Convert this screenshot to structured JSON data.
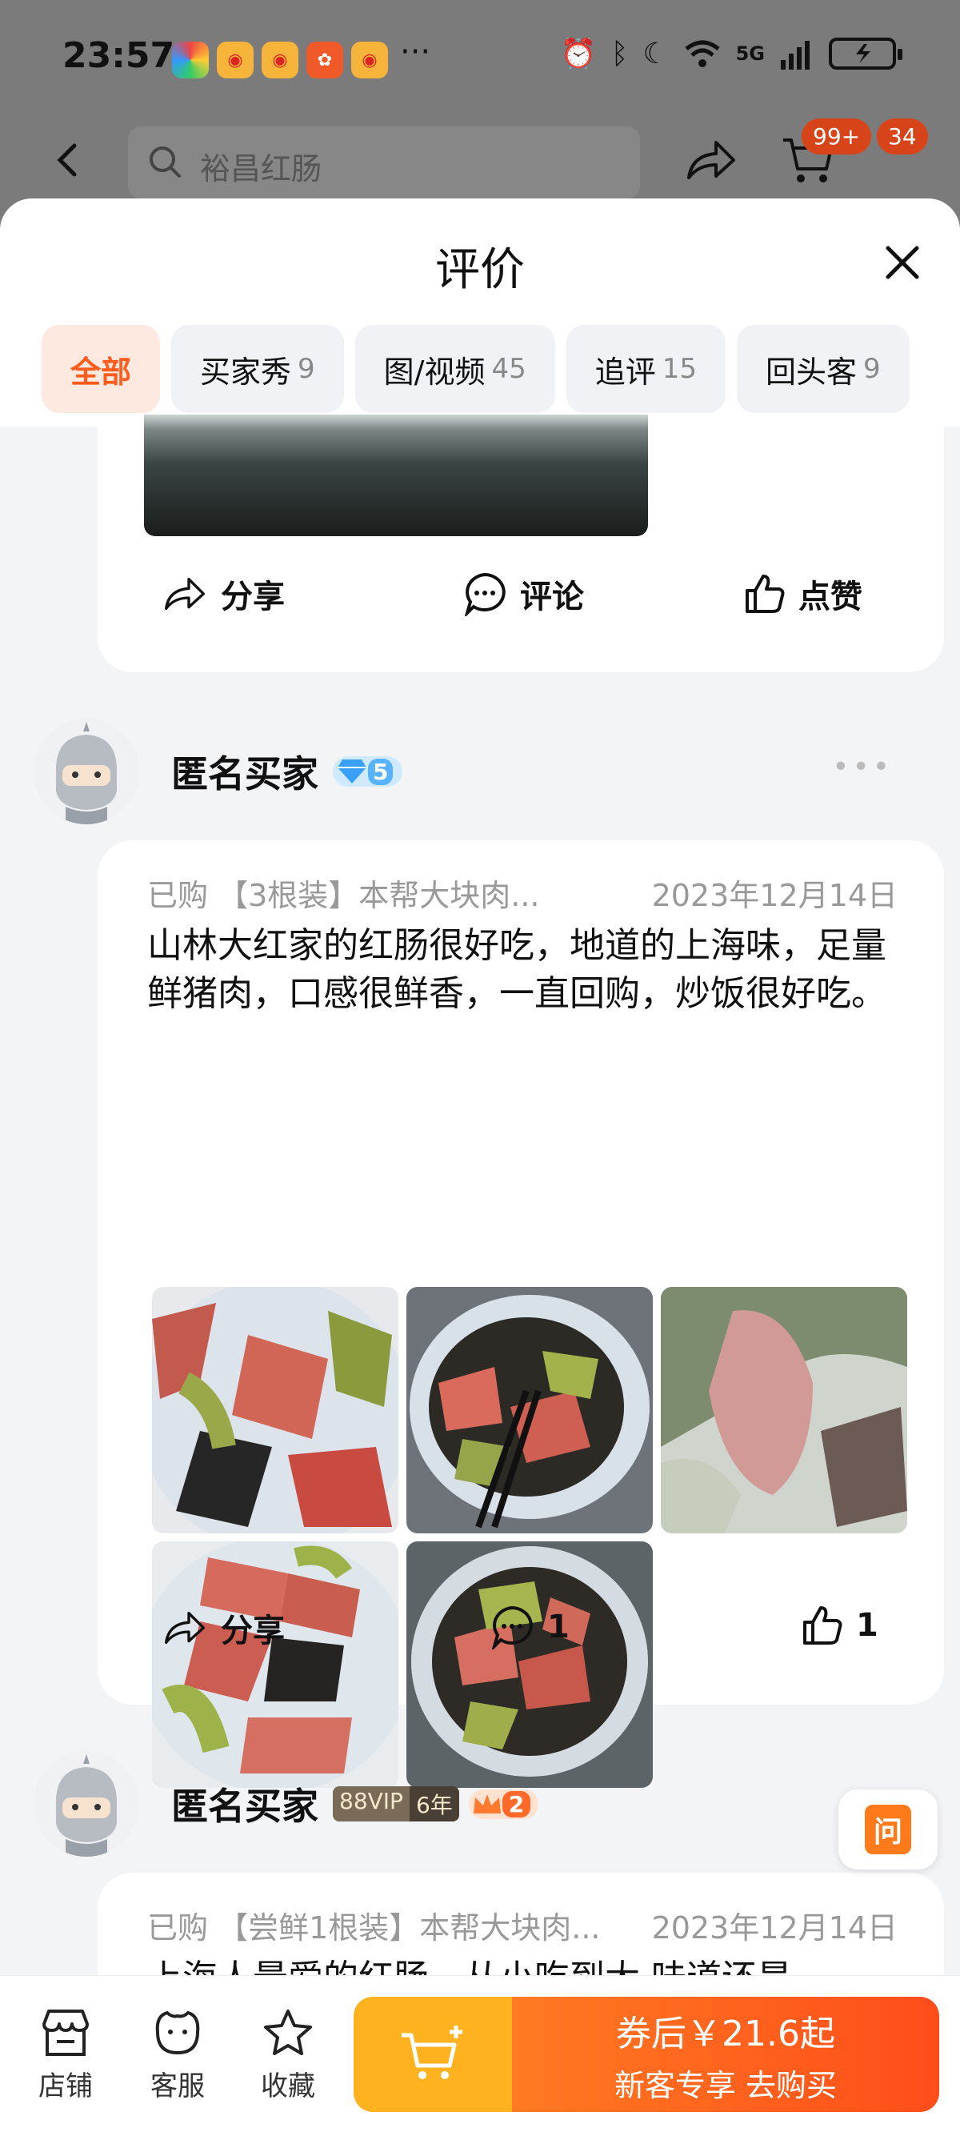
{
  "status_bar": {
    "time": "23:57",
    "more": "···",
    "network": "5G",
    "app_icons": [
      "app-icon",
      "weibo-icon",
      "weibo-icon",
      "kuaishou-icon",
      "weibo-icon"
    ]
  },
  "app_bar": {
    "search_text": "裕昌红肠",
    "cart_badge": "99+",
    "msg_badge": "34"
  },
  "sheet": {
    "title": "评价",
    "tabs": [
      {
        "label": "全部",
        "count": ""
      },
      {
        "label": "买家秀",
        "count": "9"
      },
      {
        "label": "图/视频",
        "count": "45"
      },
      {
        "label": "追评",
        "count": "15"
      },
      {
        "label": "回头客",
        "count": "9"
      }
    ]
  },
  "review1_actions": {
    "share": "分享",
    "comment": "评论",
    "like": "点赞"
  },
  "review2": {
    "user": "匿名买家",
    "level": "5",
    "product": "已购 【3根装】本帮大块肉...",
    "date": "2023年12月14日",
    "text": "山林大红家的红肠很好吃，地道的上海味，足量鲜猪肉，口感很鲜香，一直回购，炒饭很好吃。",
    "share": "分享",
    "comments": "1",
    "likes": "1"
  },
  "review3": {
    "user": "匿名买家",
    "vip": "88VIP",
    "vip_years": "6年",
    "level": "2",
    "product": "已购 【尝鲜1根装】本帮大块肉...",
    "date": "2023年12月14日",
    "text": "上海人最爱的红肠，从小吃到大 味道还是"
  },
  "ask_button": "问",
  "bottom_bar": {
    "shop": "店铺",
    "service": "客服",
    "favorite": "收藏",
    "price_line": "券后￥21.6起",
    "cta_line": "新客专享  去购买"
  },
  "colors": {
    "accent": "#ff5b1c",
    "tab_active_bg": "#fde9df",
    "buy_orange": "#ff5a1d",
    "cart_yellow": "#ffb21f"
  }
}
